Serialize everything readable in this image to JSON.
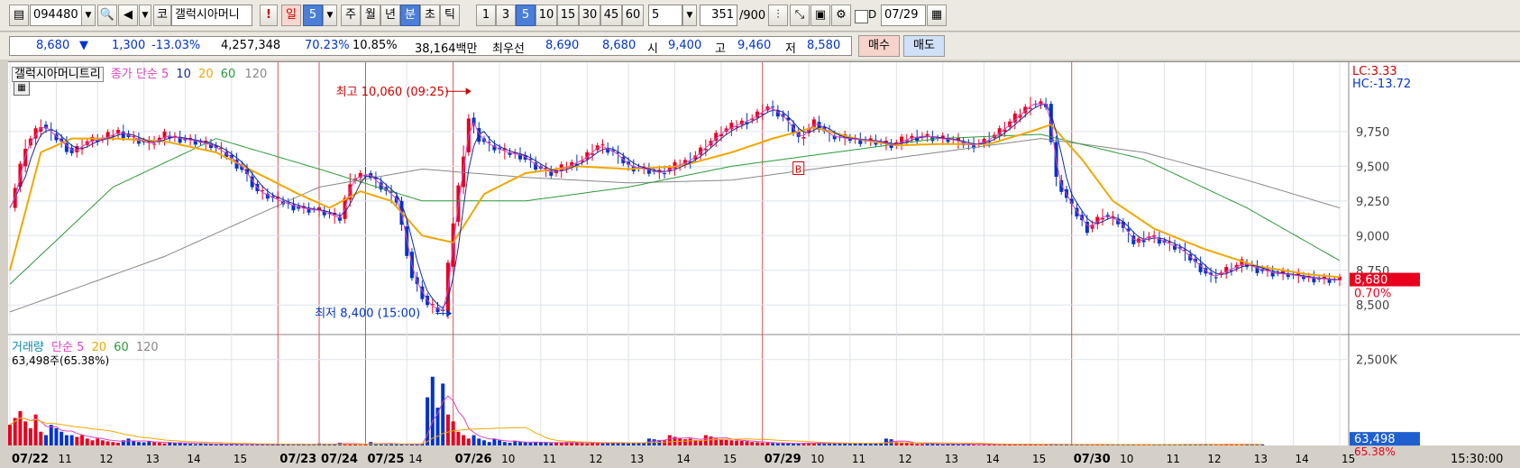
{
  "toolbar": {
    "code": "094480",
    "stock_badge": "코",
    "stock_name": "갤럭시아머니",
    "alert": "!",
    "day_label": "일",
    "day_count": "5",
    "periods": [
      "주",
      "월",
      "년",
      "분",
      "초",
      "틱"
    ],
    "active_period": "분",
    "intervals": [
      "1",
      "3",
      "5",
      "10",
      "15",
      "30",
      "45",
      "60"
    ],
    "active_interval": "5",
    "custom_interval": "5",
    "page_count": "351",
    "page_total": "/900",
    "checkbox_label": "D",
    "date": "07/29"
  },
  "quote": {
    "price": "8,680",
    "change": "1,300",
    "change_pct": "-13.03%",
    "volume": "4,257,348",
    "vol_ratio": "70.23%",
    "turnover": "10.85%",
    "amount": "38,164백만",
    "best_label": "최우선",
    "best_ask": "8,690",
    "best_bid": "8,680",
    "open_label": "시",
    "open": "9,400",
    "high_label": "고",
    "high": "9,460",
    "low_label": "저",
    "low": "8,580",
    "buy": "매수",
    "sell": "매도"
  },
  "colors": {
    "up": "#e8001e",
    "down": "#0033cc",
    "ma5": "#e040c0",
    "ma10": "#1a2a9a",
    "ma20": "#f0a800",
    "ma60": "#2c9a3a",
    "ma120": "#888888"
  },
  "chart_data": [
    {
      "type": "candlestick",
      "title": "갤럭시아머니트리",
      "legend": {
        "ma_label": "종가 단순",
        "periods": [
          "5",
          "10",
          "20",
          "60",
          "120"
        ]
      },
      "y_ticks": [
        8500,
        8750,
        9000,
        9250,
        9500,
        9750
      ],
      "ylim": [
        8300,
        10250
      ],
      "right_labels": {
        "lc": "LC:3.33",
        "hc": "HC:-13.72",
        "last_price": "8,680",
        "last_pct": "0.70%"
      },
      "annotations": {
        "high": "최고 10,060 (09:25)",
        "low": "최저 8,400 (15:00)",
        "signal": "B",
        "high_value": 10060,
        "low_value": 8400
      },
      "close_points": [
        [
          0,
          9200
        ],
        [
          3,
          9650
        ],
        [
          6,
          9800
        ],
        [
          9,
          9700
        ],
        [
          12,
          9600
        ],
        [
          15,
          9680
        ],
        [
          18,
          9700
        ],
        [
          21,
          9750
        ],
        [
          24,
          9700
        ],
        [
          27,
          9660
        ],
        [
          30,
          9720
        ],
        [
          33,
          9700
        ],
        [
          36,
          9680
        ],
        [
          39,
          9650
        ],
        [
          42,
          9580
        ],
        [
          45,
          9480
        ],
        [
          48,
          9320
        ],
        [
          52,
          9250
        ],
        [
          56,
          9200
        ],
        [
          60,
          9180
        ],
        [
          64,
          9120
        ],
        [
          66,
          9400
        ],
        [
          69,
          9450
        ],
        [
          72,
          9350
        ],
        [
          75,
          9250
        ],
        [
          78,
          8700
        ],
        [
          81,
          8500
        ],
        [
          84,
          8450
        ],
        [
          86,
          9100
        ],
        [
          89,
          9850
        ],
        [
          91,
          9700
        ],
        [
          93,
          9650
        ],
        [
          96,
          9600
        ],
        [
          99,
          9580
        ],
        [
          102,
          9500
        ],
        [
          105,
          9450
        ],
        [
          108,
          9500
        ],
        [
          111,
          9550
        ],
        [
          114,
          9650
        ],
        [
          117,
          9600
        ],
        [
          120,
          9500
        ],
        [
          123,
          9480
        ],
        [
          126,
          9450
        ],
        [
          129,
          9500
        ],
        [
          132,
          9550
        ],
        [
          135,
          9650
        ],
        [
          138,
          9750
        ],
        [
          141,
          9800
        ],
        [
          144,
          9850
        ],
        [
          147,
          9930
        ],
        [
          150,
          9850
        ],
        [
          153,
          9700
        ],
        [
          156,
          9820
        ],
        [
          159,
          9720
        ],
        [
          162,
          9700
        ],
        [
          165,
          9690
        ],
        [
          168,
          9680
        ],
        [
          171,
          9650
        ],
        [
          174,
          9700
        ],
        [
          177,
          9720
        ],
        [
          180,
          9700
        ],
        [
          183,
          9690
        ],
        [
          186,
          9650
        ],
        [
          189,
          9680
        ],
        [
          192,
          9750
        ],
        [
          195,
          9850
        ],
        [
          198,
          9950
        ],
        [
          201,
          9950
        ],
        [
          203,
          9400
        ],
        [
          206,
          9200
        ],
        [
          209,
          9050
        ],
        [
          212,
          9150
        ],
        [
          215,
          9100
        ],
        [
          218,
          8950
        ],
        [
          221,
          9000
        ],
        [
          224,
          8950
        ],
        [
          227,
          8900
        ],
        [
          230,
          8800
        ],
        [
          233,
          8700
        ],
        [
          236,
          8750
        ],
        [
          239,
          8800
        ],
        [
          242,
          8760
        ],
        [
          245,
          8730
        ],
        [
          248,
          8720
        ],
        [
          251,
          8700
        ],
        [
          254,
          8690
        ],
        [
          257,
          8680
        ],
        [
          258,
          8680
        ]
      ],
      "ma20_points": [
        [
          0,
          8750
        ],
        [
          6,
          9600
        ],
        [
          12,
          9700
        ],
        [
          20,
          9700
        ],
        [
          30,
          9680
        ],
        [
          40,
          9600
        ],
        [
          48,
          9450
        ],
        [
          56,
          9300
        ],
        [
          62,
          9200
        ],
        [
          68,
          9320
        ],
        [
          74,
          9250
        ],
        [
          80,
          9000
        ],
        [
          86,
          8950
        ],
        [
          92,
          9300
        ],
        [
          100,
          9450
        ],
        [
          110,
          9500
        ],
        [
          120,
          9480
        ],
        [
          130,
          9500
        ],
        [
          140,
          9600
        ],
        [
          148,
          9700
        ],
        [
          156,
          9780
        ],
        [
          164,
          9700
        ],
        [
          172,
          9650
        ],
        [
          180,
          9660
        ],
        [
          190,
          9660
        ],
        [
          198,
          9750
        ],
        [
          202,
          9800
        ],
        [
          208,
          9550
        ],
        [
          214,
          9250
        ],
        [
          222,
          9050
        ],
        [
          232,
          8900
        ],
        [
          242,
          8780
        ],
        [
          252,
          8720
        ],
        [
          258,
          8700
        ]
      ],
      "ma60_points": [
        [
          0,
          8650
        ],
        [
          20,
          9350
        ],
        [
          40,
          9700
        ],
        [
          60,
          9480
        ],
        [
          80,
          9250
        ],
        [
          100,
          9250
        ],
        [
          120,
          9350
        ],
        [
          140,
          9500
        ],
        [
          160,
          9600
        ],
        [
          180,
          9700
        ],
        [
          200,
          9730
        ],
        [
          220,
          9550
        ],
        [
          240,
          9200
        ],
        [
          258,
          8820
        ]
      ],
      "ma120_points": [
        [
          0,
          8450
        ],
        [
          30,
          8850
        ],
        [
          60,
          9350
        ],
        [
          80,
          9480
        ],
        [
          100,
          9420
        ],
        [
          120,
          9380
        ],
        [
          140,
          9400
        ],
        [
          160,
          9500
        ],
        [
          180,
          9600
        ],
        [
          200,
          9700
        ],
        [
          220,
          9600
        ],
        [
          240,
          9400
        ],
        [
          258,
          9200
        ]
      ]
    },
    {
      "type": "bar",
      "title": "거래량",
      "legend": {
        "ma_label": "단순",
        "periods": [
          "5",
          "20",
          "60",
          "120"
        ]
      },
      "volume_text": "63,498주(65.38%)",
      "y_ticks": [
        2500
      ],
      "y_tick_labels": [
        "2,500K"
      ],
      "ylim": [
        0,
        3200
      ],
      "right_labels": {
        "last_volume": "63,498",
        "last_pct": "65.38%"
      },
      "volumes": [
        600,
        800,
        1000,
        700,
        500,
        900,
        400,
        300,
        600,
        500,
        400,
        300,
        300,
        250,
        300,
        200,
        150,
        200,
        150,
        120,
        100,
        80,
        150,
        200,
        120,
        100,
        90,
        120,
        100,
        80,
        60,
        80,
        70,
        90,
        60,
        50,
        40,
        60,
        50,
        40,
        30,
        40,
        30,
        50,
        40,
        30,
        20,
        30,
        40,
        30,
        20,
        30,
        50,
        40,
        30,
        20,
        30,
        40,
        30,
        20,
        60,
        40,
        30,
        50,
        80,
        60,
        40,
        30,
        20,
        40,
        100,
        60,
        40,
        30,
        60,
        40,
        30,
        20,
        40,
        30,
        60,
        1400,
        2000,
        1100,
        1800,
        900,
        700,
        400,
        300,
        200,
        300,
        200,
        150,
        100,
        200,
        150,
        100,
        80,
        120,
        100,
        90,
        80,
        100,
        90,
        80,
        70,
        80,
        90,
        100,
        80,
        90,
        70,
        60,
        80,
        70,
        60,
        80,
        70,
        90,
        80,
        60,
        70,
        80,
        90,
        200,
        180,
        160,
        150,
        300,
        250,
        200,
        180,
        200,
        160,
        150,
        300,
        260,
        200,
        180,
        160,
        150,
        140,
        130,
        120,
        100,
        90,
        80,
        80,
        70,
        60,
        70,
        60,
        50,
        60,
        70,
        80,
        70,
        60,
        50,
        60,
        70,
        80,
        60,
        50,
        60,
        70,
        60,
        50,
        60,
        80,
        200,
        180,
        100,
        80,
        70,
        60,
        50,
        40,
        60,
        50,
        40,
        30,
        50,
        40,
        30,
        50,
        40,
        30,
        20,
        30,
        40,
        30,
        20,
        30,
        40,
        30,
        20,
        30,
        40,
        30,
        20,
        30,
        40,
        30,
        20,
        30,
        20,
        30,
        20,
        30,
        20,
        30,
        20,
        30,
        20,
        30,
        20,
        30,
        20,
        30,
        20,
        30,
        20,
        30,
        20,
        30,
        20,
        30,
        40,
        30,
        20,
        30,
        40,
        30,
        20,
        30,
        40,
        30,
        20,
        30,
        40,
        30,
        20,
        30
      ]
    }
  ],
  "x_axis": {
    "labels": [
      "07/22",
      "11",
      "12",
      "13",
      "14",
      "15",
      "07/23",
      "07/24",
      "07/25",
      "14",
      "07/26",
      "10",
      "11",
      "12",
      "13",
      "14",
      "15",
      "07/29",
      "10",
      "11",
      "12",
      "13",
      "14",
      "15",
      "07/30",
      "10",
      "11",
      "12",
      "13",
      "14",
      "15"
    ],
    "date_labels": [
      "07/22",
      "07/23",
      "07/24",
      "07/25",
      "07/26",
      "07/29",
      "07/30"
    ],
    "end_time": "15:30:00"
  }
}
